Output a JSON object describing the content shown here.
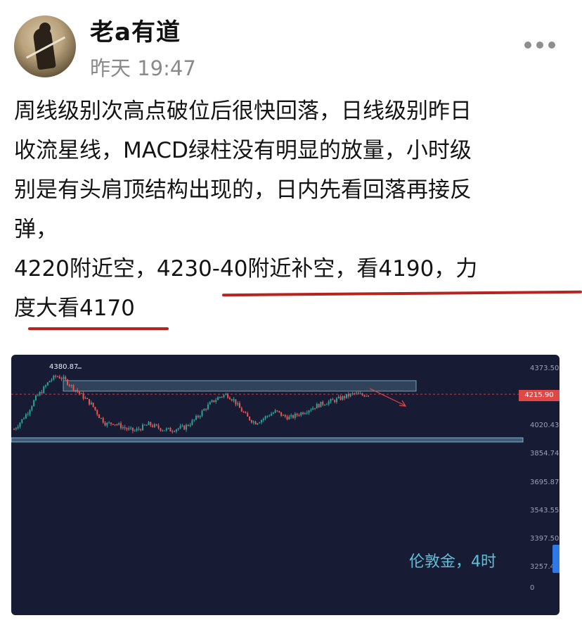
{
  "author": {
    "name": "老a有道",
    "time": "昨天 19:47"
  },
  "post": {
    "lines": [
      "周线级别次高点破位后很快回落，日线级别昨日",
      "收流星线，MACD绿柱没有明显的放量，小时级",
      "别是有头肩顶结构出现的，日内先看回落再接反",
      "弹，",
      "4220附近空，4230-40附近补空，看4190，力",
      "度大看4170"
    ]
  },
  "chart": {
    "high_label": "4380.87",
    "current_price": "4215.90",
    "y_ticks": [
      "4373.50",
      "4020.43",
      "3854.74",
      "3695.87",
      "3543.55",
      "3397.50",
      "3257.48",
      "0"
    ],
    "watermark": "伦敦金，4时",
    "colors": {
      "background": "#181b34",
      "up": "#26a69a",
      "down": "#ef5350",
      "zone": "#8fd3e8",
      "arrow": "#e04848"
    }
  },
  "chart_data": {
    "type": "candlestick",
    "title": "伦敦金，4时",
    "current_price": 4215.9,
    "high_marker": 4380.87,
    "ylim": [
      3257.48,
      4373.5
    ],
    "y_ticks": [
      4373.5,
      4020.43,
      3854.74,
      3695.87,
      3543.55,
      3397.5,
      3257.48
    ],
    "resistance_zone": [
      4235,
      4300
    ],
    "support_zone": [
      3980,
      3995
    ],
    "close_path": [
      4000,
      4050,
      4110,
      4190,
      4240,
      4300,
      4330,
      4310,
      4270,
      4230,
      4190,
      4150,
      4080,
      4030,
      4040,
      4020,
      4000,
      3990,
      4010,
      4030,
      4015,
      4000,
      3995,
      4005,
      4010,
      4040,
      4080,
      4130,
      4170,
      4200,
      4215,
      4180,
      4120,
      4070,
      4040,
      4060,
      4090,
      4110,
      4080,
      4070,
      4090,
      4110,
      4130,
      4150,
      4165,
      4175,
      4190,
      4205,
      4220,
      4210,
      4216
    ]
  }
}
